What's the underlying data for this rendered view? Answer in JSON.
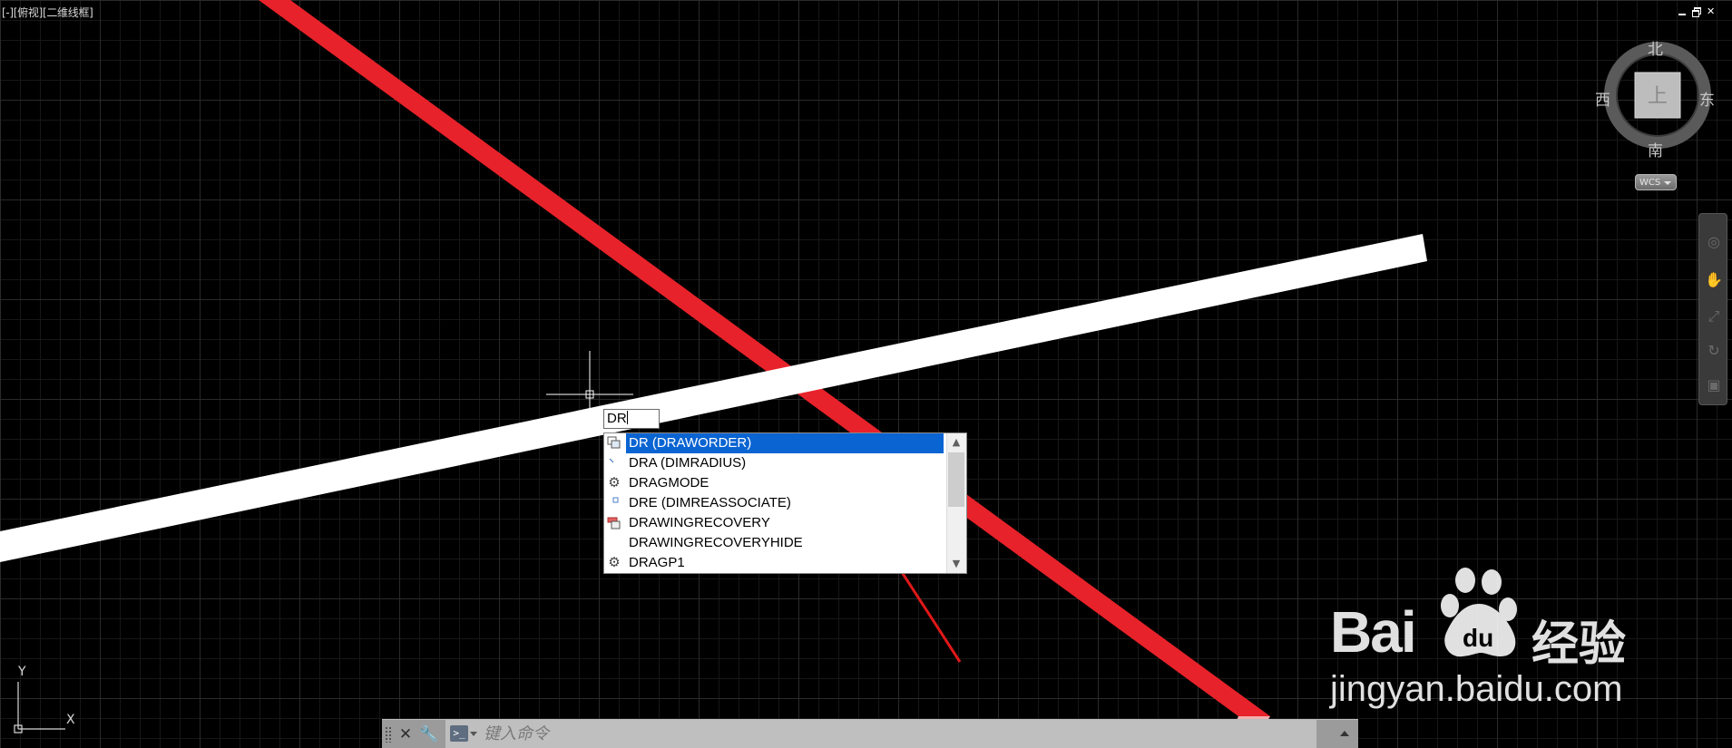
{
  "viewport": {
    "label": "[-][俯视][二维线框]"
  },
  "viewcube": {
    "north": "北",
    "south": "南",
    "east": "东",
    "west": "西",
    "face": "上",
    "wcs_label": "WCS"
  },
  "ucs": {
    "x_label": "X",
    "y_label": "Y"
  },
  "dynamic_input": {
    "value": "DR"
  },
  "autocomplete": {
    "items": [
      {
        "label": "DR (DRAWORDER)",
        "icon": "draworder-icon",
        "selected": true
      },
      {
        "label": "DRA (DIMRADIUS)",
        "icon": "dimradius-icon",
        "selected": false
      },
      {
        "label": "DRAGMODE",
        "icon": "gear-icon",
        "selected": false
      },
      {
        "label": "DRE (DIMREASSOCIATE)",
        "icon": "dimreassociate-icon",
        "selected": false
      },
      {
        "label": "DRAWINGRECOVERY",
        "icon": "drawing-recovery-icon",
        "selected": false
      },
      {
        "label": "DRAWINGRECOVERYHIDE",
        "icon": "",
        "selected": false
      },
      {
        "label": "DRAGP1",
        "icon": "gear-icon",
        "selected": false
      }
    ]
  },
  "command_line": {
    "placeholder": "键入命令"
  },
  "watermark": {
    "brand_left": "Bai",
    "brand_right": "经验",
    "paw_text": "du",
    "url": "jingyan.baidu.com"
  },
  "colors": {
    "background": "#000000",
    "red_line": "#e8222a",
    "white_line": "#ffffff",
    "selection": "#0a64d2",
    "annotation_arrow": "#e01818"
  }
}
